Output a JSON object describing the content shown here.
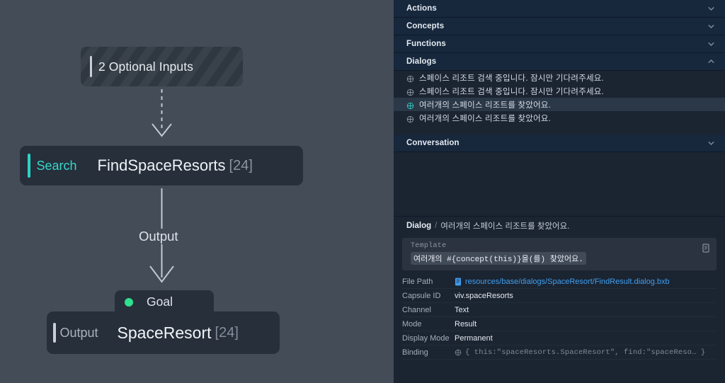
{
  "graph": {
    "optional_inputs": {
      "label": "2 Optional Inputs"
    },
    "search_node": {
      "kind": "Search",
      "name": "FindSpaceResorts",
      "count": "[24]"
    },
    "goal_node": {
      "tab_label": "Goal",
      "kind": "Output",
      "name": "SpaceResort",
      "count": "[24]"
    },
    "edge_label": "Output"
  },
  "panel": {
    "sections": [
      {
        "title": "Actions",
        "state": "collapsed",
        "chevron": "chevron-down-icon"
      },
      {
        "title": "Concepts",
        "state": "collapsed",
        "chevron": "chevron-down-icon"
      },
      {
        "title": "Functions",
        "state": "collapsed",
        "chevron": "chevron-down-icon"
      },
      {
        "title": "Dialogs",
        "state": "expanded",
        "chevron": "chevron-up-icon"
      },
      {
        "title": "Conversation",
        "state": "collapsed",
        "chevron": "chevron-down-icon"
      }
    ],
    "dialogs": [
      {
        "text": "스페이스 리조트 검색 중입니다. 잠시만 기다려주세요.",
        "icon": "globe-plus-icon",
        "selected": false
      },
      {
        "text": "스페이스 리조트 검색 중입니다. 잠시만 기다려주세요.",
        "icon": "globe-plus-icon",
        "selected": false
      },
      {
        "text": "여러개의 스페이스 리조트를 찾았어요.",
        "icon": "globe-plus-icon",
        "selected": true
      },
      {
        "text": "여러개의 스페이스 리조트를 찾았어요.",
        "icon": "globe-plus-icon",
        "selected": false
      }
    ]
  },
  "detail": {
    "breadcrumb": {
      "root": "Dialog",
      "separator": "/",
      "leaf": "여러개의 스페이스 리조트를 찾았어요."
    },
    "template": {
      "caption": "Template",
      "value": "여러개의 #{concept(this)}을(를) 찾았어요.",
      "copy_icon": "copy-document-icon"
    },
    "properties": [
      {
        "key": "File Path",
        "value": "resources/base/dialogs/SpaceResort/FindResult.dialog.bxb",
        "style": "link",
        "icon": "file-icon"
      },
      {
        "key": "Capsule ID",
        "value": "viv.spaceResorts",
        "style": "plain",
        "icon": ""
      },
      {
        "key": "Channel",
        "value": "Text",
        "style": "plain",
        "icon": ""
      },
      {
        "key": "Mode",
        "value": "Result",
        "style": "plain",
        "icon": ""
      },
      {
        "key": "Display Mode",
        "value": "Permanent",
        "style": "plain",
        "icon": ""
      },
      {
        "key": "Binding",
        "value": "{ this:\"spaceResorts.SpaceResort\", find:\"spaceReso…  }",
        "style": "mono",
        "icon": "globe-plus-icon"
      }
    ]
  },
  "colors": {
    "canvas_bg": "#434c57",
    "panel_bg": "#1b2431",
    "section_hdr_bg": "#17273c",
    "node_bg": "#262f3a",
    "accent_cyan": "#37d6cb",
    "accent_green": "#2fe08f",
    "link_blue": "#3f9ff0",
    "selected_row_bg": "#2b3847"
  }
}
